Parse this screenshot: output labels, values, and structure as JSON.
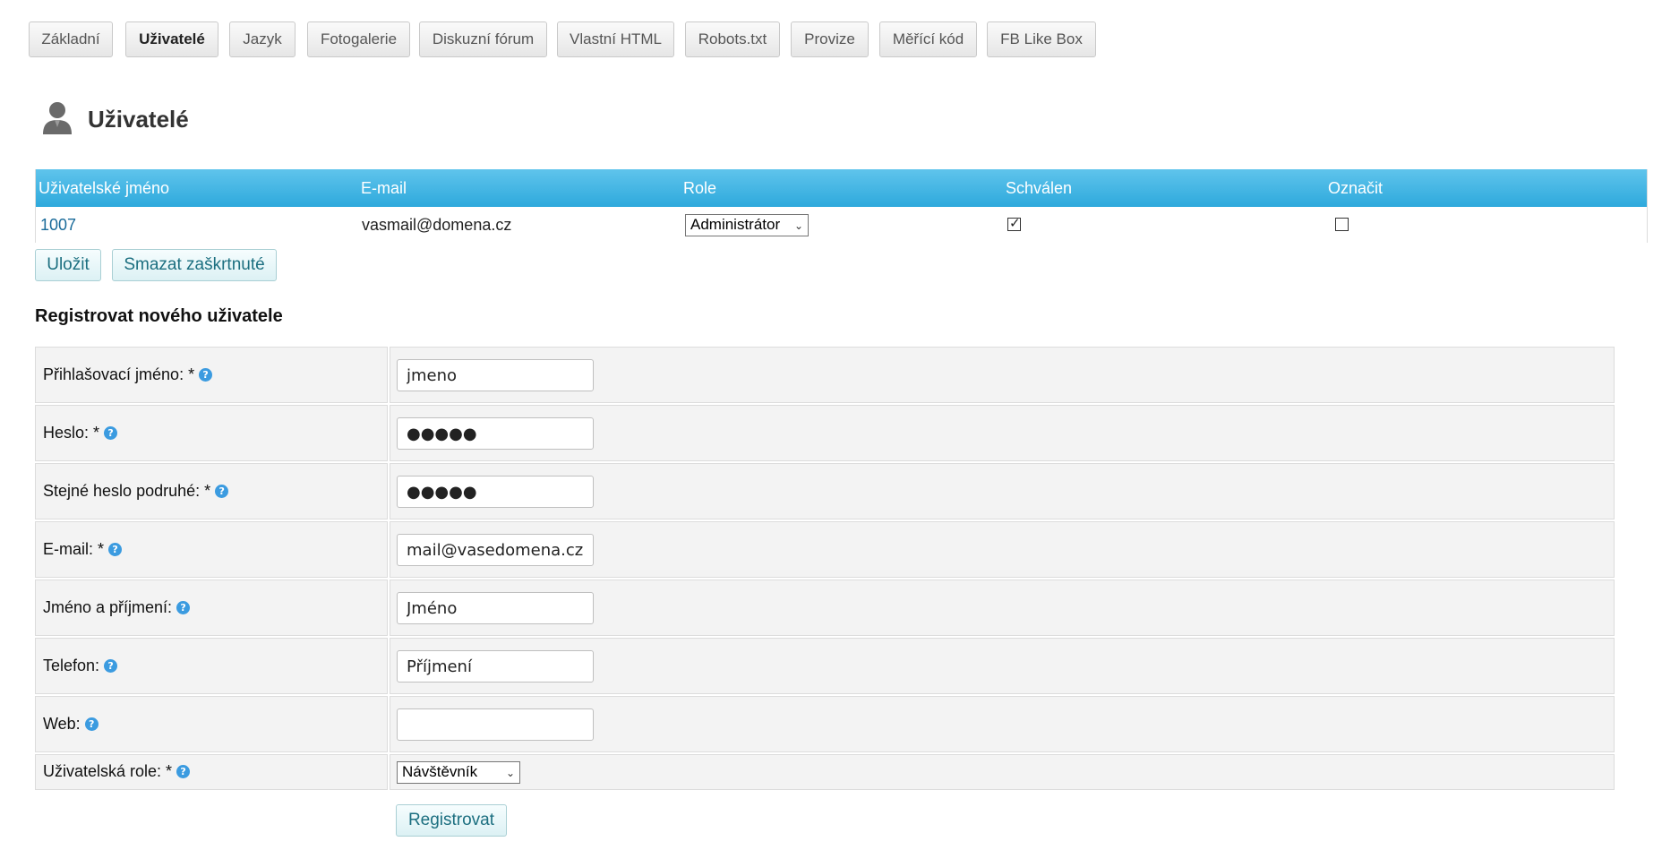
{
  "tabs": [
    {
      "label": "Základní",
      "active": false
    },
    {
      "label": "Uživatelé",
      "active": true
    },
    {
      "label": "Jazyk",
      "active": false
    },
    {
      "label": "Fotogalerie",
      "active": false
    },
    {
      "label": "Diskuzní fórum",
      "active": false
    },
    {
      "label": "Vlastní HTML",
      "active": false
    },
    {
      "label": "Robots.txt",
      "active": false
    },
    {
      "label": "Provize",
      "active": false
    },
    {
      "label": "Měřící kód",
      "active": false
    },
    {
      "label": "FB Like Box",
      "active": false
    }
  ],
  "page": {
    "title": "Uživatelé",
    "icon": "user-icon"
  },
  "users_table": {
    "headers": [
      "Uživatelské jméno",
      "E-mail",
      "Role",
      "Schválen",
      "Označit"
    ],
    "header_color": "#3bb2e3",
    "rows": [
      {
        "username": "1007",
        "email": "vasmail@domena.cz",
        "role": "Administrátor",
        "approved": true,
        "marked": false
      }
    ]
  },
  "actions": {
    "save": "Uložit",
    "delete_checked": "Smazat zaškrtnuté"
  },
  "register": {
    "title": "Registrovat nového uživatele",
    "fields": {
      "login": {
        "label": "Přihlašovací jméno: *",
        "value": "jmeno"
      },
      "password": {
        "label": "Heslo: *",
        "value": "●●●●●"
      },
      "password2": {
        "label": "Stejné heslo podruhé: *",
        "value": "●●●●●"
      },
      "email": {
        "label": "E-mail: *",
        "value": "mail@vasedomena.cz"
      },
      "name": {
        "label": "Jméno a příjmení:",
        "value": "Jméno"
      },
      "phone": {
        "label": "Telefon:",
        "value": "Příjmení"
      },
      "web": {
        "label": "Web:",
        "value": ""
      },
      "role": {
        "label": "Uživatelská role: *",
        "value": "Návštěvník"
      }
    },
    "help_icon": "help-icon",
    "submit": "Registrovat"
  }
}
